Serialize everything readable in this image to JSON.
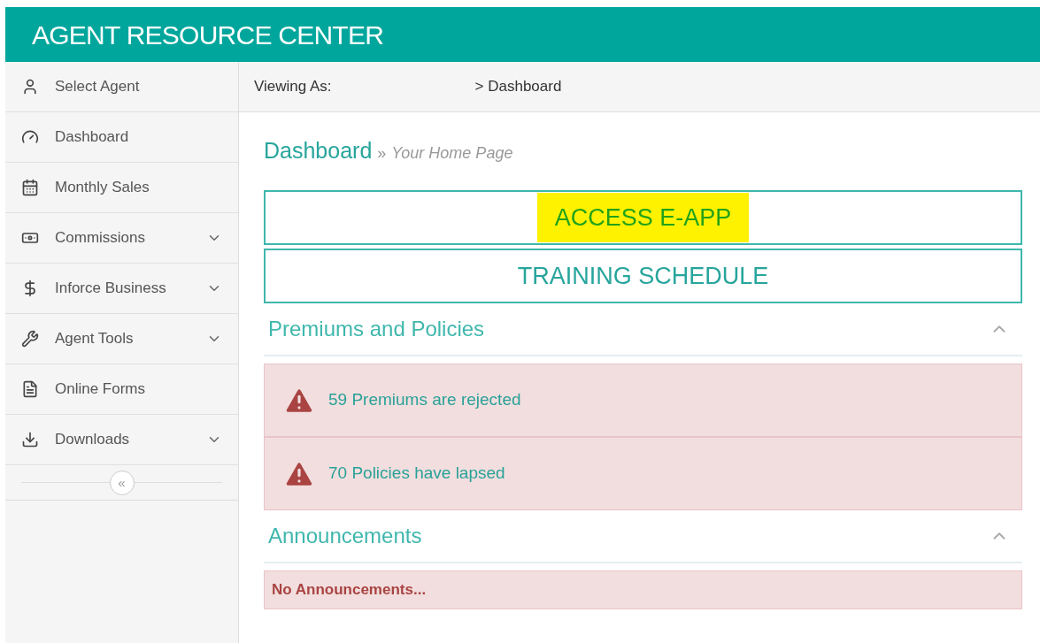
{
  "header": {
    "title": "AGENT RESOURCE CENTER"
  },
  "sidebar": {
    "items": [
      {
        "label": "Select Agent",
        "has_submenu": false
      },
      {
        "label": "Dashboard",
        "has_submenu": false
      },
      {
        "label": "Monthly Sales",
        "has_submenu": false
      },
      {
        "label": "Commissions",
        "has_submenu": true
      },
      {
        "label": "Inforce Business",
        "has_submenu": true
      },
      {
        "label": "Agent Tools",
        "has_submenu": true
      },
      {
        "label": "Online Forms",
        "has_submenu": false
      },
      {
        "label": "Downloads",
        "has_submenu": true
      }
    ],
    "collapse_button": "«"
  },
  "breadcrumb_bar": {
    "label": "Viewing As:",
    "path": "> Dashboard"
  },
  "page_heading": {
    "title": "Dashboard",
    "separator": "»",
    "subtitle": "Your Home Page"
  },
  "link_buttons": [
    {
      "label": "ACCESS E-APP",
      "highlighted": true
    },
    {
      "label": "TRAINING SCHEDULE",
      "highlighted": false
    }
  ],
  "sections": [
    {
      "title": "Premiums and Policies",
      "expanded": true,
      "alerts": [
        {
          "text": "59 Premiums are rejected",
          "kind": "warning"
        },
        {
          "text": "70 Policies have lapsed",
          "kind": "warning"
        }
      ]
    },
    {
      "title": "Announcements",
      "expanded": true,
      "alerts": [
        {
          "text": "No Announcements...",
          "kind": "message"
        }
      ]
    }
  ]
}
